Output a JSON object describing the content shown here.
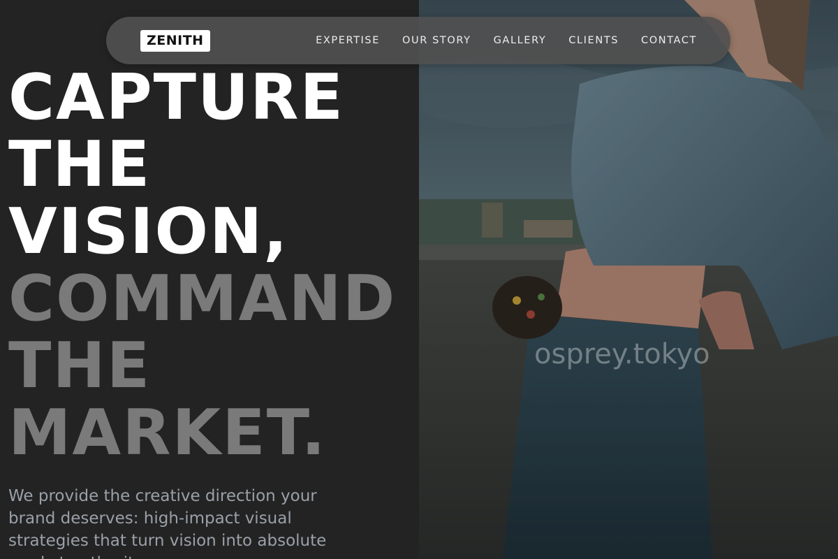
{
  "nav": {
    "logo": "ZENITH",
    "links": [
      "EXPERTISE",
      "OUR STORY",
      "GALLERY",
      "CLIENTS",
      "CONTACT"
    ]
  },
  "hero": {
    "headline_light": [
      "CAPTURE",
      "THE",
      "VISION,"
    ],
    "headline_dim": [
      "COMMAND",
      "THE",
      "MARKET."
    ],
    "subcopy": "We provide the creative direction your brand deserves: high-impact visual strategies that turn vision into absolute market authority.",
    "image_watermark": "osprey.tokyo"
  },
  "colors": {
    "background": "#232323",
    "headline_light": "#ffffff",
    "headline_dim": "#7a7a7a",
    "subcopy": "#9aa0a8",
    "nav_pill": "#505050"
  }
}
